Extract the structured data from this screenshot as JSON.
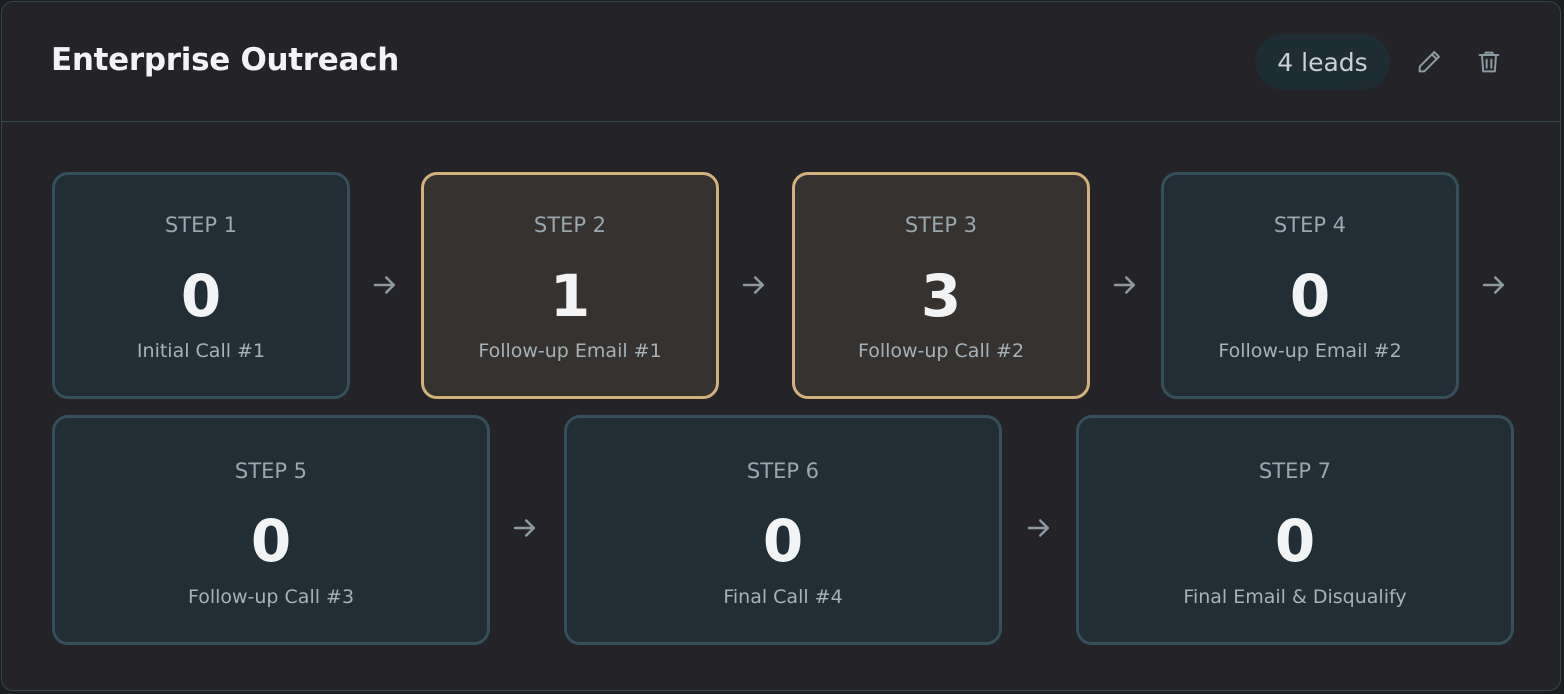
{
  "sequence": {
    "title": "Enterprise Outreach",
    "leads_badge": "4 leads"
  },
  "actions": {
    "edit_icon": "pencil-icon",
    "delete_icon": "trash-icon"
  },
  "steps": [
    {
      "label": "STEP 1",
      "count": "0",
      "name": "Initial Call #1",
      "highlighted": false
    },
    {
      "label": "STEP 2",
      "count": "1",
      "name": "Follow-up Email #1",
      "highlighted": true
    },
    {
      "label": "STEP 3",
      "count": "3",
      "name": "Follow-up Call #2",
      "highlighted": true
    },
    {
      "label": "STEP 4",
      "count": "0",
      "name": "Follow-up Email #2",
      "highlighted": false
    },
    {
      "label": "STEP 5",
      "count": "0",
      "name": "Follow-up Call #3",
      "highlighted": false
    },
    {
      "label": "STEP 6",
      "count": "0",
      "name": "Final Call #4",
      "highlighted": false
    },
    {
      "label": "STEP 7",
      "count": "0",
      "name": "Final Email & Disqualify",
      "highlighted": false
    }
  ],
  "colors": {
    "highlight_border": "#d4b07a",
    "step_border": "#34505a",
    "background": "#232328"
  }
}
